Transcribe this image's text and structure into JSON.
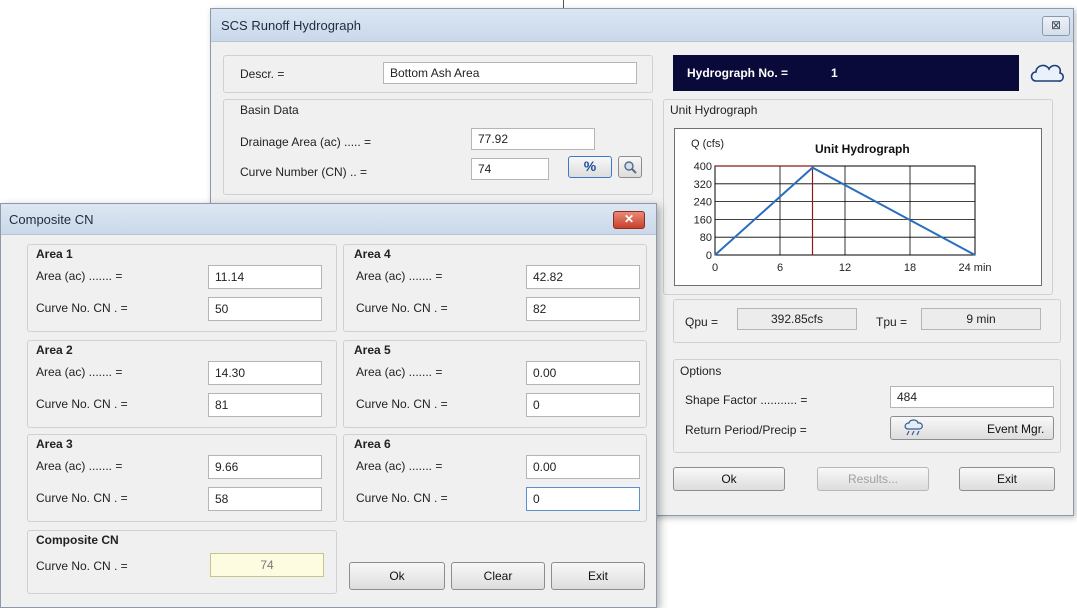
{
  "main_window": {
    "title": "SCS Runoff Hydrograph",
    "close_label": "⊠",
    "descr_label": "Descr. =",
    "descr_value": "Bottom Ash Area",
    "basin_data": {
      "title": "Basin Data",
      "drainage_label": "Drainage Area (ac) ..... =",
      "drainage_value": "77.92",
      "cn_label": "Curve Number (CN) .. =",
      "cn_value": "74",
      "percent_label": "%"
    },
    "hydrograph_no_label": "Hydrograph No. =",
    "hydrograph_no_value": "1",
    "unit_hydrograph_panel_title": "Unit Hydrograph",
    "qpu_label": "Qpu =",
    "qpu_value": "392.85cfs",
    "tpu_label": "Tpu =",
    "tpu_value": "9 min",
    "options": {
      "title": "Options",
      "shape_factor_label": "Shape Factor ........... =",
      "shape_factor_value": "484",
      "return_period_label": "Return Period/Precip =",
      "event_mgr_label": "Event Mgr."
    },
    "buttons": {
      "ok": "Ok",
      "results": "Results...",
      "exit": "Exit"
    }
  },
  "composite_dialog": {
    "title": "Composite CN",
    "close_label": "✕",
    "area_label": "Area (ac) ....... =",
    "cn_label": "Curve No. CN . =",
    "areas": [
      {
        "title": "Area 1",
        "area": "11.14",
        "cn": "50"
      },
      {
        "title": "Area 2",
        "area": "14.30",
        "cn": "81"
      },
      {
        "title": "Area 3",
        "area": "9.66",
        "cn": "58"
      },
      {
        "title": "Area 4",
        "area": "42.82",
        "cn": "82"
      },
      {
        "title": "Area 5",
        "area": "0.00",
        "cn": "0"
      },
      {
        "title": "Area 6",
        "area": "0.00",
        "cn": "0"
      }
    ],
    "composite": {
      "title": "Composite CN",
      "label": "Curve No. CN . =",
      "value": "74"
    },
    "buttons": {
      "ok": "Ok",
      "clear": "Clear",
      "exit": "Exit"
    }
  },
  "chart_data": {
    "type": "line",
    "title": "Unit Hydrograph",
    "ylabel": "Q (cfs)",
    "xlabel": "",
    "x_unit": "min",
    "x": [
      0,
      9,
      24
    ],
    "y": [
      0,
      392.85,
      0
    ],
    "peak_time": 9,
    "peak_flow": 392.85,
    "xlim": [
      0,
      24
    ],
    "ylim": [
      0,
      400
    ],
    "xticks": [
      0,
      6,
      12,
      18,
      24
    ],
    "xtick_labels": [
      "0",
      "6",
      "12",
      "18",
      "24 min"
    ],
    "yticks": [
      0,
      80,
      160,
      240,
      320,
      400
    ],
    "ytick_labels": [
      "0",
      "80",
      "160",
      "240",
      "320",
      "400"
    ],
    "grid": true,
    "colors": {
      "line": "#2a6ebf",
      "peak_marker": "#8b1a1a"
    }
  }
}
